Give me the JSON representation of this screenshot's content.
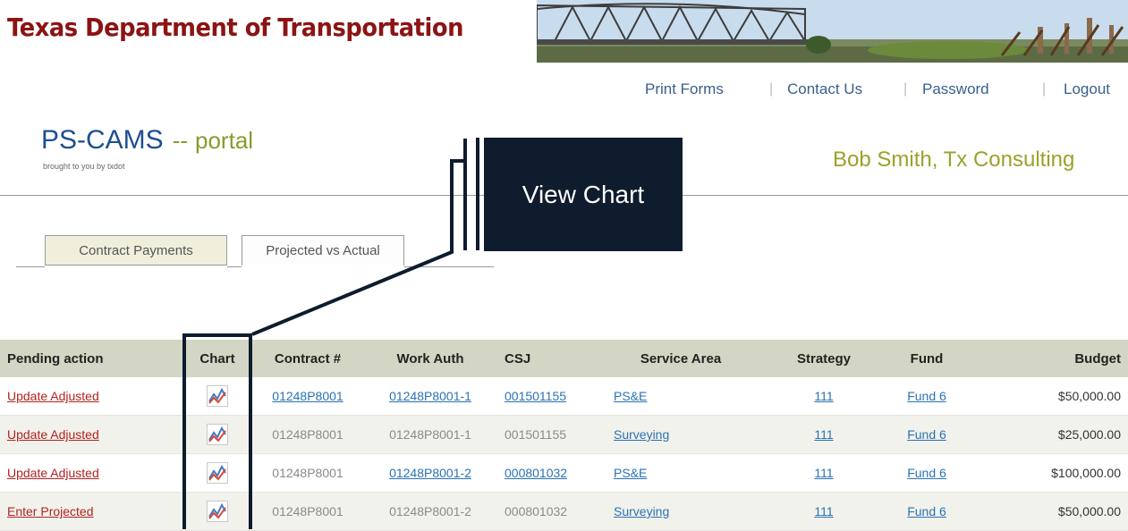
{
  "header": {
    "department": "Texas Department of Transportation"
  },
  "nav_links": [
    {
      "label": "Print Forms"
    },
    {
      "label": "Contact Us"
    },
    {
      "label": "Password"
    },
    {
      "label": "Logout"
    }
  ],
  "nav_separator": "|",
  "brand": {
    "name": "PS-CAMS",
    "dash": "--",
    "portal": "portal",
    "tagline": "brought to you by txdot"
  },
  "user": {
    "display": "Bob Smith, Tx Consulting"
  },
  "tabs": [
    {
      "label": "Contract Payments",
      "active": false
    },
    {
      "label": "Projected vs Actual",
      "active": true
    }
  ],
  "callout": {
    "label": "View Chart"
  },
  "table": {
    "headers": [
      "Pending action",
      "Chart",
      "Contract #",
      "Work Auth",
      "CSJ",
      "Service Area",
      "Strategy",
      "Fund",
      "Budget"
    ],
    "rows": [
      {
        "action": "Update Adjusted",
        "contract": "01248P8001",
        "work_auth": "01248P8001-1",
        "csj": "001501155",
        "service_area": "PS&E",
        "strategy": "111",
        "fund": "Fund 6",
        "budget": "$50,000.00"
      },
      {
        "action": "Update Adjusted",
        "contract": "01248P8001",
        "work_auth": "01248P8001-1",
        "csj": "001501155",
        "service_area": "Surveying",
        "strategy": "111",
        "fund": "Fund 6",
        "budget": "$25,000.00"
      },
      {
        "action": "Update Adjusted",
        "contract": "01248P8001",
        "work_auth": "01248P8001-2",
        "csj": "000801032",
        "service_area": "PS&E",
        "strategy": "111",
        "fund": "Fund 6",
        "budget": "$100,000.00"
      },
      {
        "action": "Enter Projected",
        "contract": "01248P8001",
        "work_auth": "01248P8001-2",
        "csj": "000801032",
        "service_area": "Surveying",
        "strategy": "111",
        "fund": "Fund 6",
        "budget": "$50,000.00"
      }
    ]
  },
  "icons": {
    "chart": "line-chart-icon"
  },
  "colors": {
    "department_title": "#8b1414",
    "brand_blue": "#1d4f91",
    "portal_olive": "#8a9a2c",
    "link_blue": "#2a72b5",
    "action_red": "#b22222",
    "callout_navy": "#0f1c2e",
    "table_header": "#d3d6c4"
  }
}
